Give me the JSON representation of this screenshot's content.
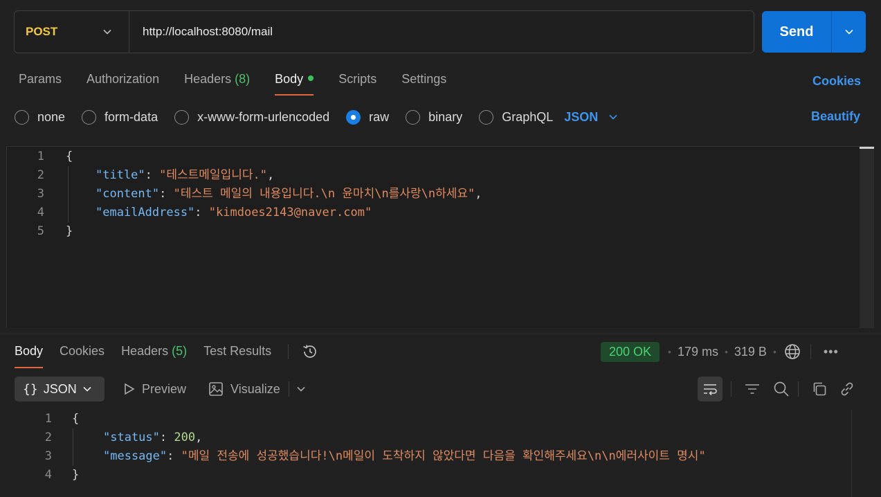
{
  "request": {
    "method": "POST",
    "url": "http://localhost:8080/mail",
    "send_label": "Send"
  },
  "request_tabs": [
    {
      "label": "Params"
    },
    {
      "label": "Authorization"
    },
    {
      "label": "Headers",
      "count": "(8)"
    },
    {
      "label": "Body"
    },
    {
      "label": "Scripts"
    },
    {
      "label": "Settings"
    }
  ],
  "cookies_label": "Cookies",
  "body_types": [
    "none",
    "form-data",
    "x-www-form-urlencoded",
    "raw",
    "binary",
    "GraphQL"
  ],
  "body_selected": "raw",
  "body_format": "JSON",
  "beautify_label": "Beautify",
  "request_body": {
    "line_numbers": [
      "1",
      "2",
      "3",
      "4",
      "5"
    ],
    "open": "{",
    "close": "}",
    "fields": [
      {
        "key": "\"title\"",
        "value": "\"테스트메일입니다.\"",
        "tail": ","
      },
      {
        "key": "\"content\"",
        "value": "\"테스트 메일의 내용입니다.\\n 윤마치\\n를사랑\\n하세요\"",
        "tail": ","
      },
      {
        "key": "\"emailAddress\"",
        "value": "\"kimdoes2143@naver.com\"",
        "tail": ""
      }
    ]
  },
  "response_tabs": [
    {
      "label": "Body"
    },
    {
      "label": "Cookies"
    },
    {
      "label": "Headers",
      "count": "(5)"
    },
    {
      "label": "Test Results"
    }
  ],
  "response_status": {
    "status": "200 OK",
    "time": "179 ms",
    "size": "319 B"
  },
  "response_toolbar": {
    "format": "JSON",
    "preview": "Preview",
    "visualize": "Visualize"
  },
  "response_body": {
    "line_numbers": [
      "1",
      "2",
      "3",
      "4"
    ],
    "open": "{",
    "close": "}",
    "status_key": "\"status\"",
    "status_value": "200",
    "message_key": "\"message\"",
    "message_value": "\"메일 전송에 성공했습니다!\\n메일이 도착하지 않았다면 다음을 확인해주세요\\n\\n에러사이트 명시\""
  },
  "colors": {
    "accent": "#0f72d8",
    "method": "#f5c93d",
    "status_ok": "#4cd271",
    "active_tab": "#e2673f"
  }
}
